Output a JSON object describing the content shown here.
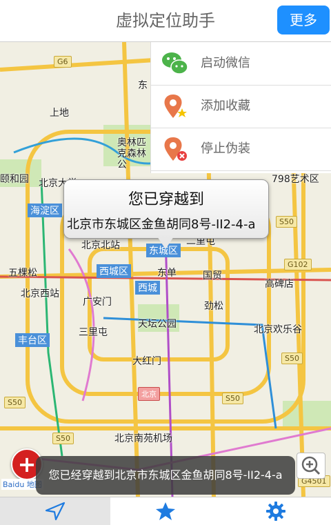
{
  "header": {
    "title": "虚拟定位助手",
    "more_label": "更多"
  },
  "menu": [
    {
      "label": "启动微信",
      "icon": "wechat-icon"
    },
    {
      "label": "添加收藏",
      "icon": "pin-star-icon"
    },
    {
      "label": "停止伪装",
      "icon": "pin-cancel-icon"
    }
  ],
  "bubble": {
    "title": "您已穿越到",
    "address": "北京市东城区金鱼胡同8号-II2-4-a"
  },
  "toast": {
    "text": "您已经穿越到北京市东城区金鱼胡同8号-II2-4-a"
  },
  "map": {
    "places": [
      "上地",
      "奥林匹克森林公",
      "颐和园",
      "北京大学",
      "798艺术区",
      "海淀区",
      "北京北站",
      "东城区",
      "二里屯",
      "五棵松",
      "西城区",
      "东单",
      "国贸",
      "高碑店",
      "北京西站",
      "西城",
      "广安门",
      "劲松",
      "三里屯",
      "天坛公园",
      "北京欢乐谷",
      "丰台区",
      "大红门",
      "北京",
      "北京南苑机场",
      "东"
    ],
    "roads": [
      "G6",
      "S50",
      "G102",
      "S50",
      "S50",
      "S50",
      "S50",
      "G4501"
    ],
    "logo": "Baidu 地图"
  },
  "tabs": [
    {
      "icon": "location-arrow-icon",
      "active": true
    },
    {
      "icon": "star-icon",
      "active": false
    },
    {
      "icon": "gear-icon",
      "active": false
    }
  ],
  "colors": {
    "accent": "#1e90ff",
    "tab_icon": "#1e7be0",
    "road": "#f4c542",
    "toast_bg": "#3c3c3c"
  }
}
